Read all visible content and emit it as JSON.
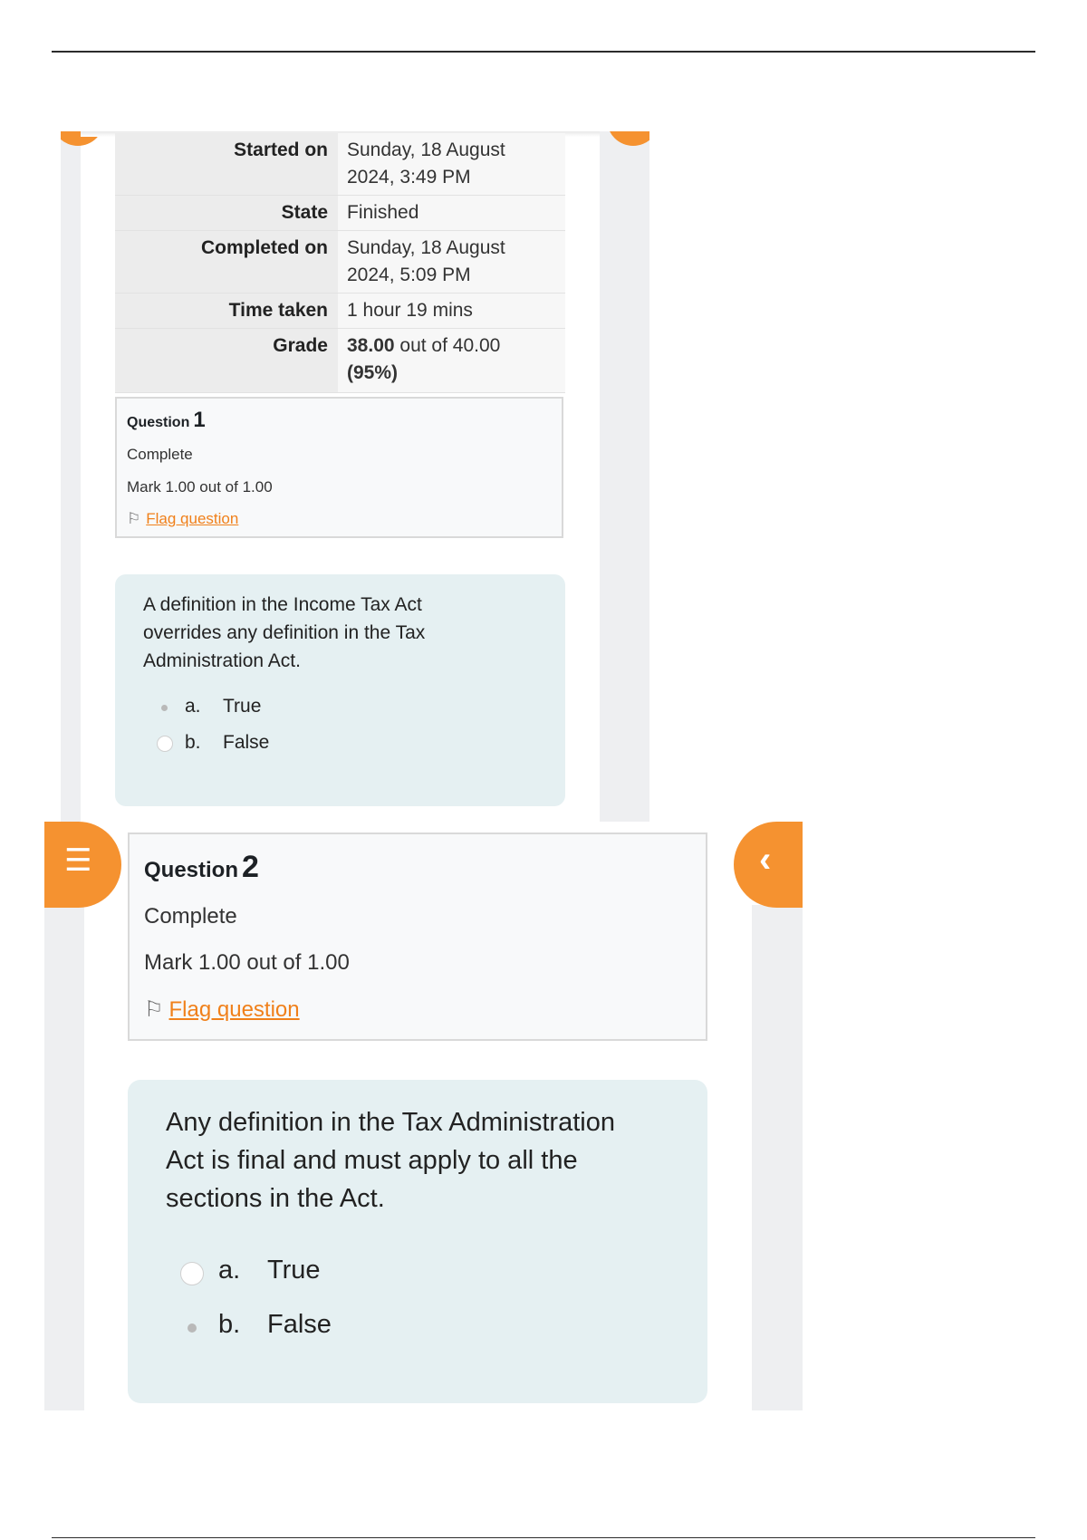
{
  "summary": {
    "rows": [
      {
        "label": "Started on",
        "value": "Sunday, 18 August 2024, 3:49 PM"
      },
      {
        "label": "State",
        "value": "Finished"
      },
      {
        "label": "Completed on",
        "value": "Sunday, 18 August 2024, 5:09 PM"
      },
      {
        "label": "Time taken",
        "value": "1 hour 19 mins"
      }
    ],
    "grade_label": "Grade",
    "grade_score": "38.00",
    "grade_rest": "out of 40.00",
    "grade_percent": "(95%)"
  },
  "questions": [
    {
      "title_label": "Question",
      "number": "1",
      "status": "Complete",
      "mark": "Mark 1.00 out of 1.00",
      "flag_label": "Flag question",
      "text": "A definition in the Income Tax Act overrides any definition in the Tax Administration Act.",
      "options": [
        {
          "letter": "a.",
          "text": "True",
          "selected": true
        },
        {
          "letter": "b.",
          "text": "False",
          "selected": false
        }
      ]
    },
    {
      "title_label": "Question",
      "number": "2",
      "status": "Complete",
      "mark": "Mark 1.00 out of 1.00",
      "flag_label": "Flag question",
      "text": "Any definition in the Tax Administration Act is final and must apply to all the sections in the Act.",
      "options": [
        {
          "letter": "a.",
          "text": "True",
          "selected": false
        },
        {
          "letter": "b.",
          "text": "False",
          "selected": true
        }
      ]
    }
  ],
  "icons": {
    "nav_drawer": "list-icon",
    "collapse": "chevron-left-icon",
    "flag": "flag-icon"
  },
  "colors": {
    "accent": "#f59230",
    "link": "#f0801a",
    "question_bg": "#e5f0f2"
  }
}
